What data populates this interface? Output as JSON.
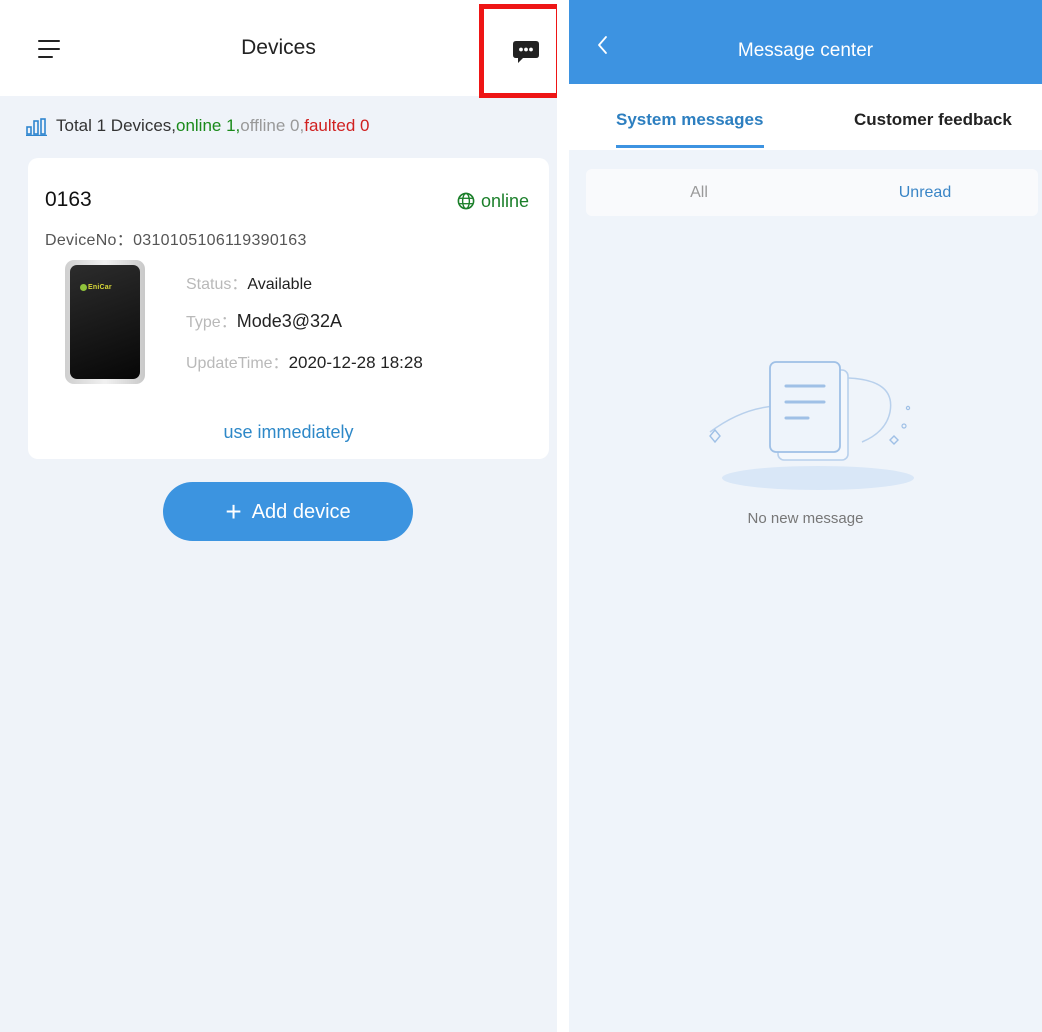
{
  "left": {
    "title": "Devices",
    "summary": {
      "prefix": "Total 1 Devices,",
      "online": "online 1,",
      "offline": "offline 0,",
      "faulted": "faulted 0"
    },
    "device": {
      "name": "0163",
      "status": "online",
      "device_no_label": "DeviceNo：",
      "device_no": "0310105106119390163",
      "status_label": "Status：",
      "status_value": "Available",
      "type_label": "Type：",
      "type_value": "Mode3@32A",
      "update_label": "UpdateTime：",
      "update_value": "2020-12-28 18:28",
      "image_logo": "EniCar",
      "use_label": "use immediately"
    },
    "add_button": {
      "plus": "+",
      "label": "Add device"
    },
    "icons": [
      "menu-icon",
      "chat-bubble-icon",
      "bar-chart-icon",
      "globe-icon"
    ]
  },
  "right": {
    "title": "Message center",
    "tabs": [
      "System messages",
      "Customer feedback"
    ],
    "filters": [
      "All",
      "Unread"
    ],
    "empty_text": "No new message",
    "icons": [
      "back-icon",
      "empty-document-illustration"
    ]
  },
  "colors": {
    "primary": "#3d93e1",
    "online": "#1a8a1a",
    "faulted": "#d02020",
    "highlight_box": "#ee1515"
  }
}
